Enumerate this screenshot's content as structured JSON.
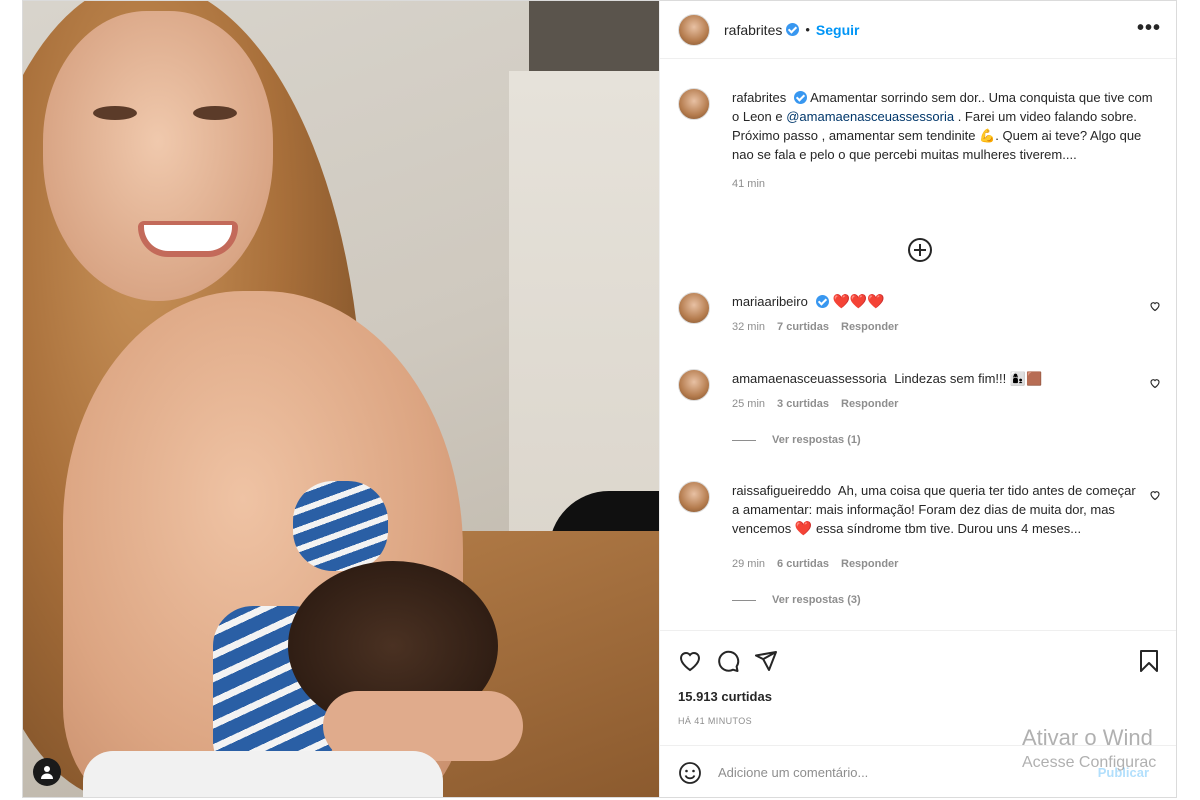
{
  "post": {
    "username": "rafabrites",
    "follow_label": "Seguir",
    "separator": "•",
    "more_icon": "more-dots-icon"
  },
  "caption": {
    "username": "rafabrites",
    "text_before_mention": "Amamentar sorrindo sem dor.. Uma conquista que tive com o Leon e",
    "mention": "@amamaenasceuassessoria",
    "text_after_mention": ". Farei um video falando sobre. Próximo passo , amamentar sem tendinite 💪. Quem ai teve? Algo que nao se fala e pelo o que percebi muitas mulheres tiverem....",
    "time": "41 min"
  },
  "comments": [
    {
      "username": "mariaaribeiro",
      "verified": true,
      "text": "❤️❤️❤️",
      "time": "32 min",
      "likes": "7 curtidas",
      "reply": "Responder",
      "replies": ""
    },
    {
      "username": "amamaenasceuassessoria",
      "verified": false,
      "text": "Lindezas sem fim!!! 👩‍👦🟫",
      "time": "25 min",
      "likes": "3 curtidas",
      "reply": "Responder",
      "replies": "Ver respostas (1)"
    },
    {
      "username": "raissafigueireddo",
      "verified": false,
      "text_before_heart": "Ah, uma coisa que queria ter tido antes de começar a amamentar: mais informação! Foram dez dias de muita dor, mas vencemos",
      "heart": "❤️",
      "text_after_heart": "essa síndrome tbm tive. Durou uns 4 meses...",
      "time": "29 min",
      "likes": "6 curtidas",
      "reply": "Responder",
      "replies": "Ver respostas (3)"
    }
  ],
  "footer": {
    "likes_count": "15.913 curtidas",
    "posted_time": "HÁ 41 MINUTOS",
    "comment_placeholder": "Adicione um comentário...",
    "publish_label": "Publicar"
  },
  "watermark": {
    "line1": "Ativar o Wind",
    "line2": "Acesse Configurac"
  },
  "colors": {
    "link_blue": "#0095f6",
    "verified_blue": "#3897f0",
    "heart_red": "#ed4956",
    "mention": "#00376b"
  }
}
